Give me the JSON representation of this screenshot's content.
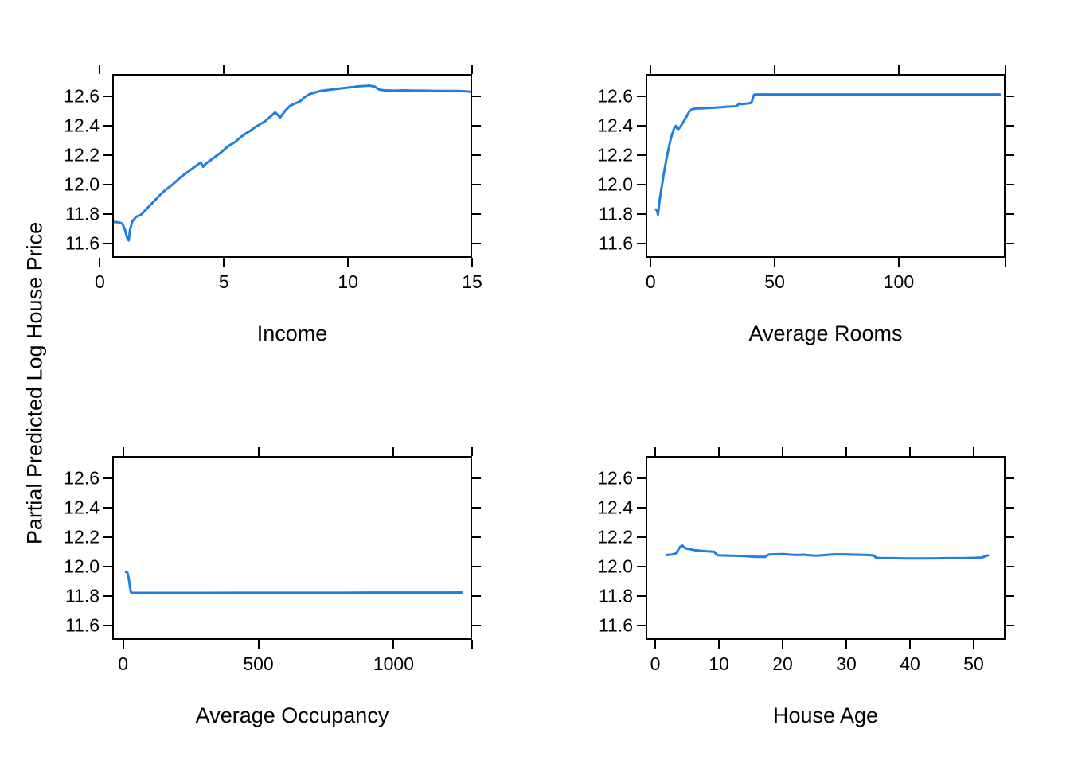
{
  "figure": {
    "shared_ylabel": "Partial Predicted Log House Price",
    "line_color": "#1f7fe0",
    "axis_color": "#000000",
    "background": "#ffffff",
    "layout": "2x2 grid of partial dependence plots"
  },
  "chart_data": [
    {
      "type": "line",
      "title": "",
      "xlabel": "Income",
      "ylabel": "Partial Predicted Log House Price",
      "xlim": [
        0.5,
        15.0
      ],
      "ylim": [
        11.5,
        12.75
      ],
      "xticks": [
        0,
        5,
        10,
        15
      ],
      "yticks": [
        11.6,
        11.8,
        12.0,
        12.2,
        12.4,
        12.6
      ],
      "grid": false,
      "legend": "none",
      "x": [
        0.5,
        0.7,
        0.85,
        0.95,
        1.05,
        1.1,
        1.15,
        1.25,
        1.4,
        1.6,
        1.8,
        2.0,
        2.2,
        2.4,
        2.6,
        2.8,
        3.0,
        3.2,
        3.4,
        3.6,
        3.8,
        4.0,
        4.1,
        4.2,
        4.4,
        4.6,
        4.8,
        5.0,
        5.2,
        5.4,
        5.6,
        5.8,
        6.0,
        6.2,
        6.4,
        6.6,
        6.8,
        7.0,
        7.2,
        7.4,
        7.6,
        7.8,
        8.0,
        8.2,
        8.4,
        8.6,
        8.8,
        9.0,
        9.5,
        10.0,
        10.4,
        10.8,
        11.0,
        11.2,
        11.4,
        11.8,
        12.2,
        12.6,
        13.0,
        13.5,
        14.0,
        14.5,
        14.9
      ],
      "y": [
        11.755,
        11.752,
        11.742,
        11.7,
        11.64,
        11.63,
        11.7,
        11.76,
        11.79,
        11.805,
        11.84,
        11.875,
        11.91,
        11.945,
        11.975,
        12.0,
        12.03,
        12.06,
        12.085,
        12.11,
        12.135,
        12.16,
        12.13,
        12.15,
        12.175,
        12.2,
        12.225,
        12.255,
        12.28,
        12.3,
        12.33,
        12.355,
        12.375,
        12.4,
        12.42,
        12.44,
        12.47,
        12.5,
        12.465,
        12.51,
        12.545,
        12.56,
        12.575,
        12.605,
        12.625,
        12.635,
        12.645,
        12.65,
        12.66,
        12.67,
        12.678,
        12.682,
        12.676,
        12.655,
        12.65,
        12.648,
        12.65,
        12.648,
        12.648,
        12.646,
        12.646,
        12.645,
        12.64
      ]
    },
    {
      "type": "line",
      "title": "",
      "xlabel": "Average Rooms",
      "ylabel": "Partial Predicted Log House Price",
      "xlim": [
        -2,
        143
      ],
      "ylim": [
        11.5,
        12.75
      ],
      "xticks": [
        0,
        50,
        100
      ],
      "yticks": [
        11.6,
        11.8,
        12.0,
        12.2,
        12.4,
        12.6
      ],
      "grid": false,
      "legend": "none",
      "x": [
        1.5,
        2.0,
        2.3,
        2.6,
        3.0,
        3.5,
        4.0,
        4.5,
        5.0,
        5.5,
        6.0,
        6.5,
        7.0,
        7.5,
        8.0,
        8.5,
        9.0,
        9.5,
        10.0,
        10.5,
        11.0,
        11.5,
        12.0,
        12.5,
        13.0,
        13.5,
        14.0,
        14.5,
        15.0,
        16.0,
        17.0,
        18.0,
        19.0,
        20.0,
        21.0,
        22.0,
        24.0,
        26.0,
        28.0,
        30.0,
        32.0,
        34.0,
        35.0,
        36.0,
        37.0,
        38.0,
        39.0,
        40.0,
        41.0,
        42.0,
        50.0,
        60.0,
        70.0,
        80.0,
        90.0,
        100.0,
        110.0,
        120.0,
        130.0,
        140.0
      ],
      "y": [
        11.84,
        11.83,
        11.805,
        11.845,
        11.905,
        11.96,
        12.01,
        12.065,
        12.115,
        12.16,
        12.205,
        12.245,
        12.285,
        12.32,
        12.35,
        12.375,
        12.398,
        12.408,
        12.392,
        12.386,
        12.396,
        12.405,
        12.42,
        12.432,
        12.448,
        12.462,
        12.478,
        12.492,
        12.508,
        12.52,
        12.525,
        12.527,
        12.527,
        12.527,
        12.528,
        12.529,
        12.531,
        12.533,
        12.535,
        12.538,
        12.54,
        12.542,
        12.56,
        12.556,
        12.558,
        12.56,
        12.562,
        12.566,
        12.62,
        12.622,
        12.622,
        12.622,
        12.622,
        12.622,
        12.622,
        12.622,
        12.622,
        12.622,
        12.622,
        12.622
      ]
    },
    {
      "type": "line",
      "title": "",
      "xlabel": "Average Occupancy",
      "ylabel": "Partial Predicted Log House Price",
      "xlim": [
        -40,
        1290
      ],
      "ylim": [
        11.5,
        12.75
      ],
      "xticks": [
        0,
        500,
        1000
      ],
      "yticks": [
        11.6,
        11.8,
        12.0,
        12.2,
        12.4,
        12.6
      ],
      "grid": false,
      "legend": "none",
      "x": [
        5,
        10,
        14,
        17,
        20,
        23,
        26,
        30,
        40,
        60,
        100,
        200,
        300,
        400,
        500,
        600,
        700,
        800,
        900,
        1000,
        1100,
        1200,
        1245
      ],
      "y": [
        11.972,
        11.968,
        11.94,
        11.905,
        11.868,
        11.836,
        11.83,
        11.83,
        11.83,
        11.83,
        11.83,
        11.83,
        11.83,
        11.831,
        11.831,
        11.831,
        11.831,
        11.831,
        11.832,
        11.832,
        11.832,
        11.832,
        11.833
      ]
    },
    {
      "type": "line",
      "title": "",
      "xlabel": "House Age",
      "ylabel": "Partial Predicted Log House Price",
      "xlim": [
        -1.5,
        55
      ],
      "ylim": [
        11.5,
        12.75
      ],
      "xticks": [
        0,
        10,
        20,
        30,
        40,
        50
      ],
      "yticks": [
        11.6,
        11.8,
        12.0,
        12.2,
        12.4,
        12.6
      ],
      "grid": false,
      "legend": "none",
      "x": [
        1.5,
        2.0,
        2.5,
        3.0,
        3.3,
        3.6,
        4.0,
        4.3,
        4.6,
        5.0,
        5.5,
        6.0,
        7.0,
        8.0,
        9.0,
        9.5,
        10.0,
        11.0,
        12.0,
        13.0,
        14.0,
        15.0,
        16.0,
        17.0,
        17.5,
        18.0,
        19.0,
        20.0,
        21.0,
        22.0,
        23.0,
        24.0,
        25.0,
        26.0,
        27.0,
        28.0,
        29.0,
        30.0,
        31.0,
        32.0,
        33.0,
        34.0,
        34.5,
        35.0,
        36.0,
        37.0,
        38.0,
        40.0,
        42.0,
        44.0,
        46.0,
        48.0,
        50.0,
        51.0,
        51.5,
        52.0
      ],
      "y": [
        12.088,
        12.089,
        12.092,
        12.1,
        12.118,
        12.14,
        12.152,
        12.14,
        12.132,
        12.13,
        12.124,
        12.12,
        12.116,
        12.112,
        12.11,
        12.086,
        12.085,
        12.084,
        12.083,
        12.082,
        12.08,
        12.076,
        12.075,
        12.075,
        12.09,
        12.092,
        12.093,
        12.094,
        12.09,
        12.088,
        12.09,
        12.086,
        12.083,
        12.086,
        12.09,
        12.092,
        12.092,
        12.091,
        12.09,
        12.089,
        12.088,
        12.085,
        12.068,
        12.067,
        12.066,
        12.066,
        12.065,
        12.064,
        12.064,
        12.065,
        12.066,
        12.066,
        12.068,
        12.07,
        12.078,
        12.085
      ]
    }
  ]
}
